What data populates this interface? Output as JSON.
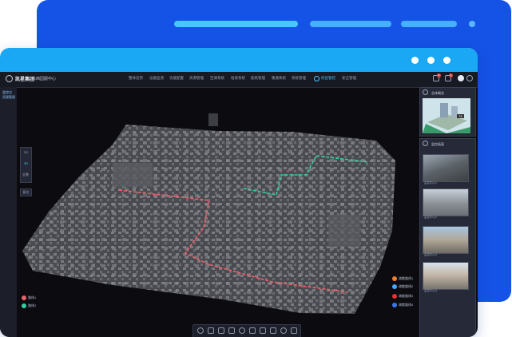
{
  "topnav": {
    "brand": "凯星集团",
    "subtitle": "东西园服中心",
    "items": [
      "整体态势",
      "设备监测",
      "功能配置",
      "资源管理",
      "空调系统",
      "给排系统",
      "能耗管理",
      "暖通系统",
      "系统管理",
      "综合管控",
      "安全管理"
    ],
    "active_index": 9,
    "badges": [
      "3",
      "2"
    ]
  },
  "leftbar": {
    "line1": "监控点",
    "line2": "资源管理"
  },
  "map_tools": {
    "items": [
      "2D",
      "3D",
      "全景"
    ],
    "reset": "复位"
  },
  "legend_left": [
    {
      "label": "路线1",
      "color": "#f0626a"
    },
    {
      "label": "路线2",
      "color": "#2fd1a0"
    }
  ],
  "legend_right": [
    {
      "label": "疏散路线1",
      "color": "#f07f2a"
    },
    {
      "label": "疏散路线2",
      "color": "#4aa6ff"
    },
    {
      "label": "疏散路线3",
      "color": "#e63232"
    },
    {
      "label": "疏散路线4",
      "color": "#3a78f0"
    }
  ],
  "overview_panel": {
    "title": "总体概览",
    "tag": "T8"
  },
  "camera_panel": {
    "title": "监控画面",
    "cams": [
      "监控中心1",
      "监控中心2",
      "监控中心3",
      "监控中心4"
    ]
  },
  "toolbar_icons": [
    "eye-icon",
    "layers-icon",
    "cube-icon",
    "measure-icon",
    "compass-icon",
    "camera-icon",
    "box-icon",
    "area-icon",
    "search-icon",
    "chart-icon"
  ]
}
